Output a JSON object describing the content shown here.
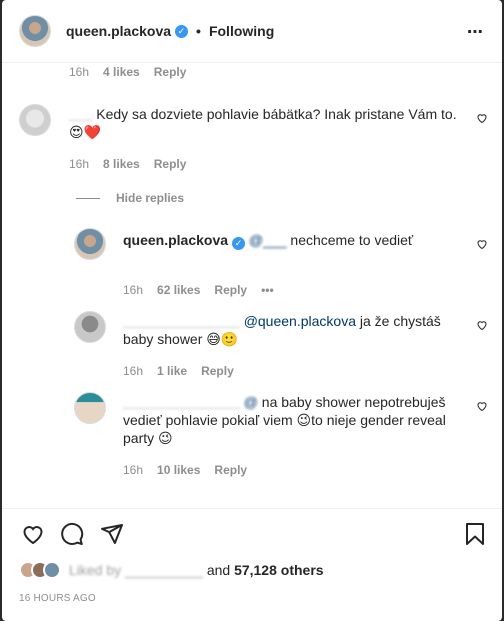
{
  "header": {
    "username": "queen.plackova",
    "verified_mark": "✓",
    "separator": "•",
    "follow_status": "Following",
    "more_icon": "⋯"
  },
  "top_meta": {
    "time": "16h",
    "likes": "4 likes",
    "reply": "Reply"
  },
  "comment1": {
    "username": "___",
    "text": "Kedy sa dozviete pohlavie bábätka? Inak pristane Vám to.",
    "emoji": "😍❤️",
    "meta": {
      "time": "16h",
      "likes": "8 likes",
      "reply": "Reply"
    }
  },
  "hide_replies": "Hide replies",
  "reply1": {
    "username": "queen.plackova",
    "mention": "@___",
    "text": "nechceme to vedieť",
    "meta": {
      "time": "16h",
      "likes": "62 likes",
      "reply": "Reply",
      "more": "•••"
    }
  },
  "reply2": {
    "username": "",
    "mention": "@queen.plackova",
    "text": "ja že chystáš baby shower",
    "emoji": "😅🙂",
    "meta": {
      "time": "16h",
      "likes": "1 like",
      "reply": "Reply"
    }
  },
  "reply3": {
    "username": "",
    "mention": "@",
    "text1": "na baby shower nepotrebuješ vedieť pohlavie pokiaľ viem",
    "emoji1": "😉",
    "text2": "to nieje gender reveal party",
    "emoji2": "😉",
    "meta": {
      "time": "16h",
      "likes": "10 likes",
      "reply": "Reply"
    }
  },
  "likes": {
    "liked_by": "Liked by",
    "user": "",
    "and": "and",
    "others": "57,128 others"
  },
  "posted": "16 HOURS AGO",
  "icons": {
    "heart": "heart-icon",
    "comment": "comment-icon",
    "share": "share-icon",
    "save": "bookmark-icon"
  }
}
